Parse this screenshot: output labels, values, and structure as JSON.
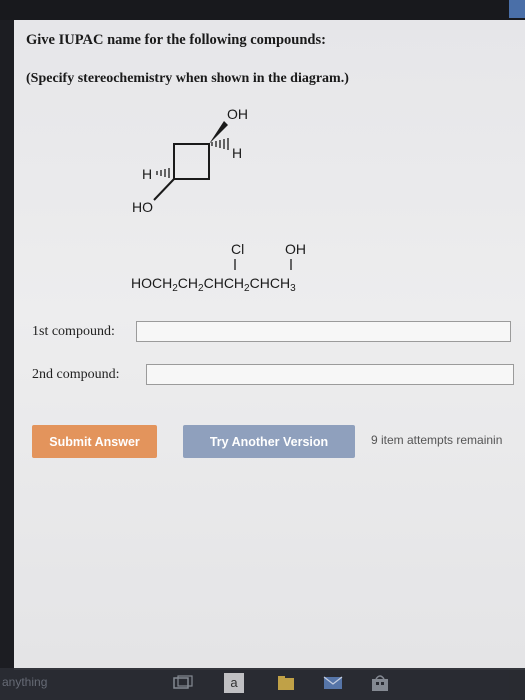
{
  "question": {
    "title": "Give IUPAC name for the following compounds:",
    "subtitle": "(Specify stereochemistry when shown in the diagram.)"
  },
  "structure1": {
    "oh_label": "OH",
    "h_right": "H",
    "h_left": "H",
    "ho_label": "HO"
  },
  "structure2": {
    "cl_label": "Cl",
    "oh_label": "OH",
    "formula_parts": [
      "HOCH",
      "2",
      "CH",
      "2",
      "CHCH",
      "2",
      "CHCH",
      "3"
    ]
  },
  "form": {
    "first_label": "1st compound:",
    "first_value": "",
    "second_label": "2nd compound:",
    "second_value": ""
  },
  "buttons": {
    "submit": "Submit Answer",
    "try_another": "Try Another Version",
    "attempts": "9 item attempts remainin"
  },
  "taskbar": {
    "search_text": "anything",
    "app_letter": "a"
  }
}
